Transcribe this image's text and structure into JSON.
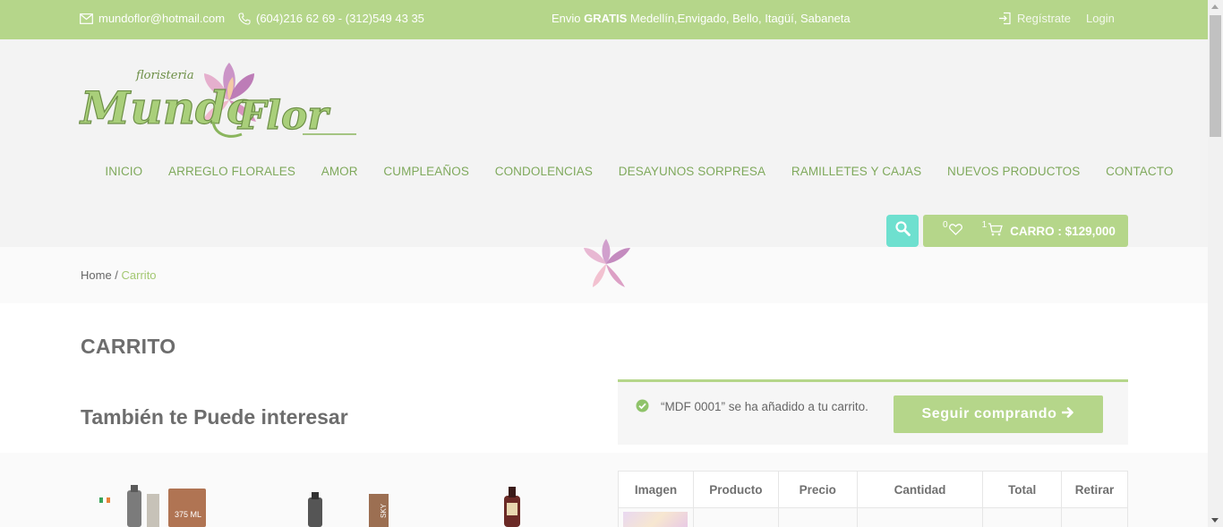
{
  "topbar": {
    "email": "mundoflor@hotmail.com",
    "phones": "(604)216 62 69 - (312)549 43 35",
    "shipping_prefix": "Envio ",
    "shipping_bold": "GRATIS",
    "shipping_rest": " Medellín,Envigado, Bello, Itagüí, Sabaneta",
    "register_label": "Regístrate",
    "login_label": "Login",
    "color": "#b5d68a"
  },
  "logo": {
    "main_text": "Mundo Flor",
    "sub_text": "floristeria"
  },
  "nav": {
    "items": [
      {
        "label": "INICIO"
      },
      {
        "label": "ARREGLO FLORALES"
      },
      {
        "label": "AMOR"
      },
      {
        "label": "CUMPLEAÑOS"
      },
      {
        "label": "CONDOLENCIAS"
      },
      {
        "label": "DESAYUNOS SORPRESA"
      },
      {
        "label": "RAMILLETES Y CAJAS"
      },
      {
        "label": "NUEVOS PRODUCTOS"
      },
      {
        "label": "CONTACTO"
      }
    ]
  },
  "header_actions": {
    "search_icon": "search-icon",
    "wishlist_count": "0",
    "cart_count": "1",
    "cart_label": "CARRO : $129,000",
    "search_color": "#6ee0cf"
  },
  "breadcrumb": {
    "home": "Home",
    "separator": " / ",
    "current": "Carrito"
  },
  "page": {
    "title": "CARRITO",
    "related_title": "También te Puede interesar"
  },
  "notice": {
    "message": "“MDF 0001” se ha añadido a tu carrito.",
    "button_label": "Seguir comprando"
  },
  "cart_table": {
    "headers": [
      "Imagen",
      "Producto",
      "Precio",
      "Cantidad",
      "Total",
      "Retirar"
    ]
  },
  "related_products": {
    "items": [
      {
        "badge": "375 ML"
      },
      {
        "badge": "SKY"
      },
      {
        "badge": ""
      }
    ]
  }
}
